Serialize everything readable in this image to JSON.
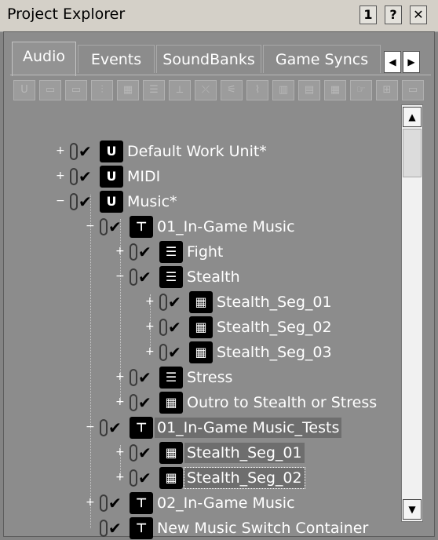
{
  "window": {
    "title": "Project Explorer",
    "buttons": [
      {
        "label": "1",
        "icon": "number-1-icon"
      },
      {
        "label": "?",
        "icon": "help-icon"
      },
      {
        "label": "✕",
        "icon": "close-icon"
      }
    ]
  },
  "tabs": [
    {
      "label": "Audio",
      "active": true
    },
    {
      "label": "Events",
      "active": false
    },
    {
      "label": "SoundBanks",
      "active": false
    },
    {
      "label": "Game Syncs",
      "active": false
    }
  ],
  "tab_nav": {
    "left": "◀",
    "right": "▶"
  },
  "toolbar": {
    "icons": [
      "work-unit-icon",
      "folder-icon",
      "virtual-folder-icon",
      "actor-mixer-icon",
      "random-container-icon",
      "sequence-container-icon",
      "switch-container-icon",
      "blend-container-icon",
      "sound-sfx-icon",
      "sound-voice-icon",
      "music-switch-icon",
      "music-playlist-icon",
      "music-segment-icon",
      "music-track-icon",
      "bus-icon",
      "aux-bus-icon"
    ],
    "glyphs": [
      "U",
      "▭",
      "▭",
      "⫶",
      "▦",
      "☰",
      "⟂",
      "⤫",
      "⚟",
      "⌇",
      "▥",
      "▤",
      "▦",
      "☞",
      "⊞",
      "▭"
    ]
  },
  "tree": [
    {
      "label": "Default Work Unit*",
      "expander": "+",
      "icon": "work-unit-icon",
      "glyph": "U",
      "level": 0
    },
    {
      "label": "MIDI",
      "expander": "+",
      "icon": "work-unit-icon",
      "glyph": "U",
      "level": 0
    },
    {
      "label": "Music*",
      "expander": "−",
      "icon": "work-unit-icon",
      "glyph": "U",
      "level": 0
    },
    {
      "label": "01_In-Game Music",
      "expander": "−",
      "icon": "music-switch-container-icon",
      "glyph": "⊤",
      "level": 1
    },
    {
      "label": "Fight",
      "expander": "+",
      "icon": "music-playlist-icon",
      "glyph": "☰",
      "level": 2
    },
    {
      "label": "Stealth",
      "expander": "−",
      "icon": "music-playlist-icon",
      "glyph": "☰",
      "level": 2
    },
    {
      "label": "Stealth_Seg_01",
      "expander": "+",
      "icon": "music-segment-icon",
      "glyph": "▦",
      "level": 3
    },
    {
      "label": "Stealth_Seg_02",
      "expander": "+",
      "icon": "music-segment-icon",
      "glyph": "▦",
      "level": 3
    },
    {
      "label": "Stealth_Seg_03",
      "expander": "+",
      "icon": "music-segment-icon",
      "glyph": "▦",
      "level": 3
    },
    {
      "label": "Stress",
      "expander": "+",
      "icon": "music-playlist-icon",
      "glyph": "☰",
      "level": 2
    },
    {
      "label": "Outro to Stealth or Stress",
      "expander": "+",
      "icon": "music-segment-icon",
      "glyph": "▦",
      "level": 2
    },
    {
      "label": "01_In-Game Music_Tests",
      "expander": "−",
      "icon": "music-switch-container-icon",
      "glyph": "⊤",
      "level": 1,
      "selected": true
    },
    {
      "label": "Stealth_Seg_01",
      "expander": "+",
      "icon": "music-segment-icon",
      "glyph": "▦",
      "level": 2,
      "selected": true
    },
    {
      "label": "Stealth_Seg_02",
      "expander": "+",
      "icon": "music-segment-icon",
      "glyph": "▦",
      "level": 2,
      "selected": true,
      "focused": true
    },
    {
      "label": "02_In-Game Music",
      "expander": "+",
      "icon": "music-switch-container-icon",
      "glyph": "⊤",
      "level": 1
    },
    {
      "label": "New Music Switch Container",
      "expander": "",
      "icon": "music-switch-container-icon",
      "glyph": "⊤",
      "level": 1
    }
  ],
  "checkmark": "✔",
  "scrollbar": {
    "up": "▲",
    "down": "▼"
  }
}
